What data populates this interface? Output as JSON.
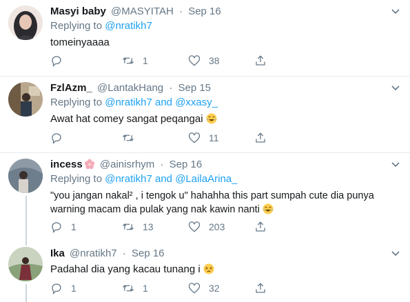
{
  "tweets": [
    {
      "name": "Masyi baby",
      "handle": "@MASYITAH",
      "dot": "·",
      "date": "Sep 16",
      "replying_prefix": "Replying to",
      "mentions": [
        "@nratikh7"
      ],
      "text": "tomeinyaaaa",
      "counts": {
        "reply": "",
        "retweet": "1",
        "like": "38"
      }
    },
    {
      "name": "FzlAzm_",
      "handle": "@LantakHang",
      "dot": "·",
      "date": "Sep 15",
      "replying_prefix": "Replying to",
      "mentions": [
        "@nratikh7",
        "@xxasy_"
      ],
      "and_word": "and",
      "text": "Awat hat comey sangat peqangai",
      "emoji": "😂",
      "counts": {
        "reply": "",
        "retweet": "",
        "like": "11"
      }
    },
    {
      "name": "incess",
      "name_emoji": "🌸",
      "handle": "@ainisrhym",
      "dot": "·",
      "date": "Sep 16",
      "replying_prefix": "Replying to",
      "mentions": [
        "@nratikh7",
        "@LailaArina_"
      ],
      "and_word": "and",
      "text_line1": "\"you jangan nakal² , i tengok u\" hahahha this part sumpah cute dia punya",
      "text_line2": "warning macam dia pulak yang nak kawin nanti",
      "emoji": "😂",
      "counts": {
        "reply": "1",
        "retweet": "13",
        "like": "203"
      }
    },
    {
      "name": "Ika",
      "handle": "@nratikh7",
      "dot": "·",
      "date": "Sep 16",
      "text": "Padahal dia yang kacau tunang i",
      "emoji": "😫",
      "counts": {
        "reply": "1",
        "retweet": "1",
        "like": "32"
      }
    }
  ],
  "colors": {
    "link": "#1da1f2",
    "secondary": "#657786",
    "divider": "#e6ecf0",
    "thread_line": "#ccd6dd"
  }
}
